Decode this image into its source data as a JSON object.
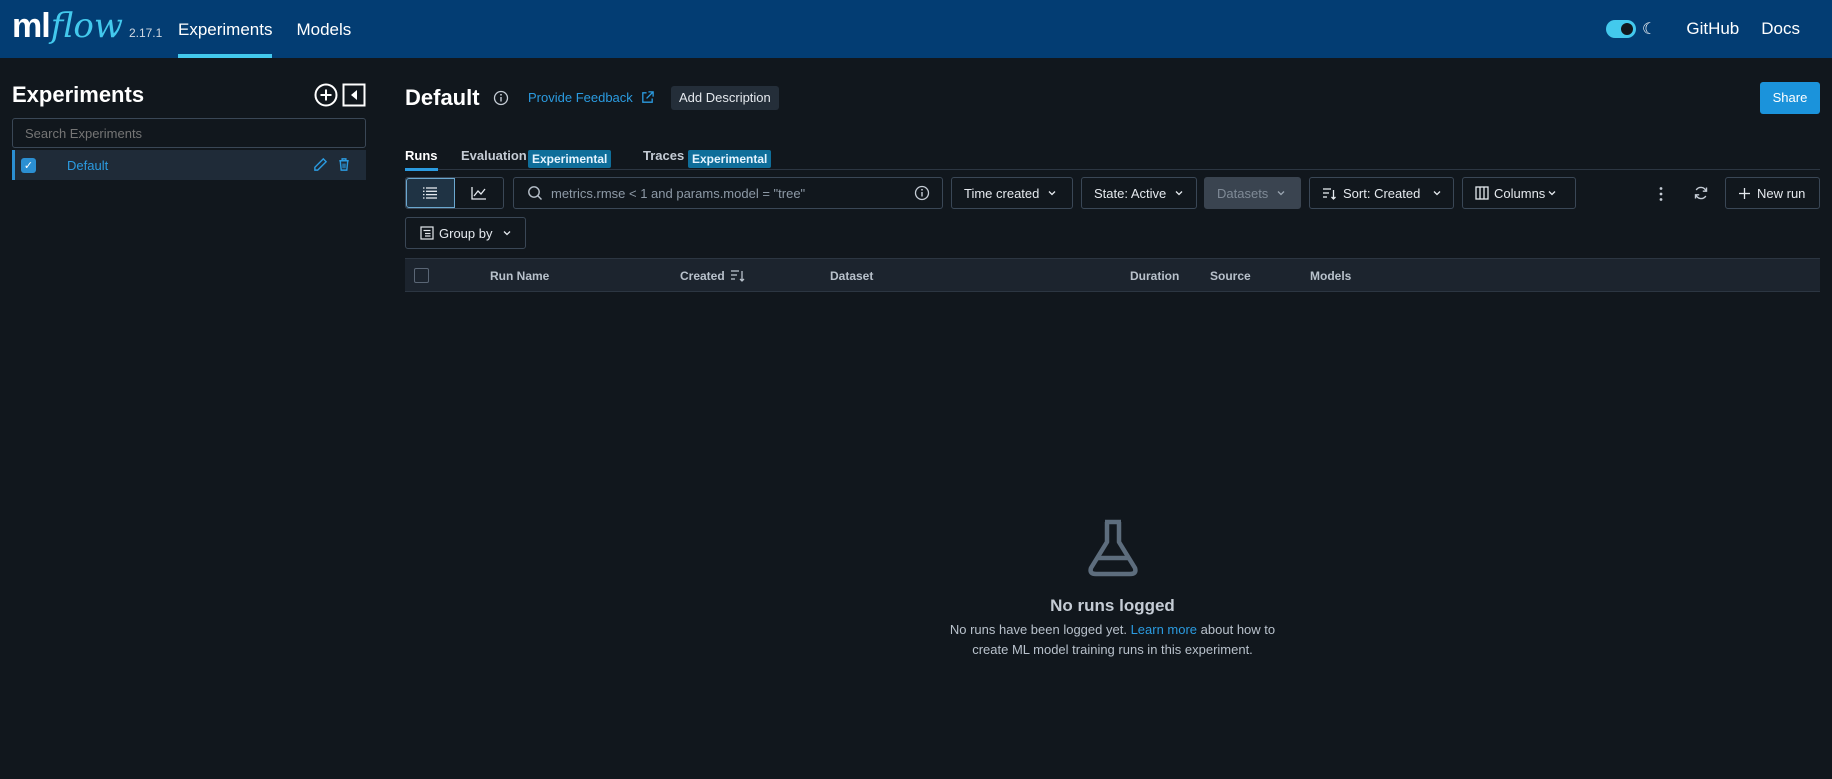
{
  "header": {
    "logo_ml": "ml",
    "logo_flow": "flow",
    "version": "2.17.1",
    "nav": [
      "Experiments",
      "Models"
    ],
    "links": [
      "GitHub",
      "Docs"
    ]
  },
  "sidebar": {
    "title": "Experiments",
    "search_placeholder": "Search Experiments",
    "items": [
      {
        "label": "Default",
        "checked": true
      }
    ]
  },
  "main": {
    "title": "Default",
    "feedback": "Provide Feedback",
    "add_description": "Add Description",
    "share": "Share",
    "tabs": [
      {
        "label": "Runs"
      },
      {
        "label": "Evaluation",
        "badge": "Experimental"
      },
      {
        "label": "Traces",
        "badge": "Experimental"
      }
    ],
    "search_placeholder": "metrics.rmse < 1 and params.model = \"tree\"",
    "filters": {
      "time": "Time created",
      "state": "State: Active",
      "datasets": "Datasets",
      "sort": "Sort: Created",
      "columns": "Columns",
      "new_run": "New run",
      "group_by": "Group by"
    },
    "columns": [
      "Run Name",
      "Created",
      "Dataset",
      "Duration",
      "Source",
      "Models"
    ],
    "empty": {
      "title": "No runs logged",
      "desc_before": "No runs have been logged yet.",
      "link": "Learn more",
      "desc_after": "about how to",
      "desc_line2": "create ML model training runs in this experiment."
    }
  },
  "colors": {
    "topbar": "#033d73",
    "accent": "#43c9ed",
    "link": "#2b9be0",
    "background": "#11171d"
  }
}
